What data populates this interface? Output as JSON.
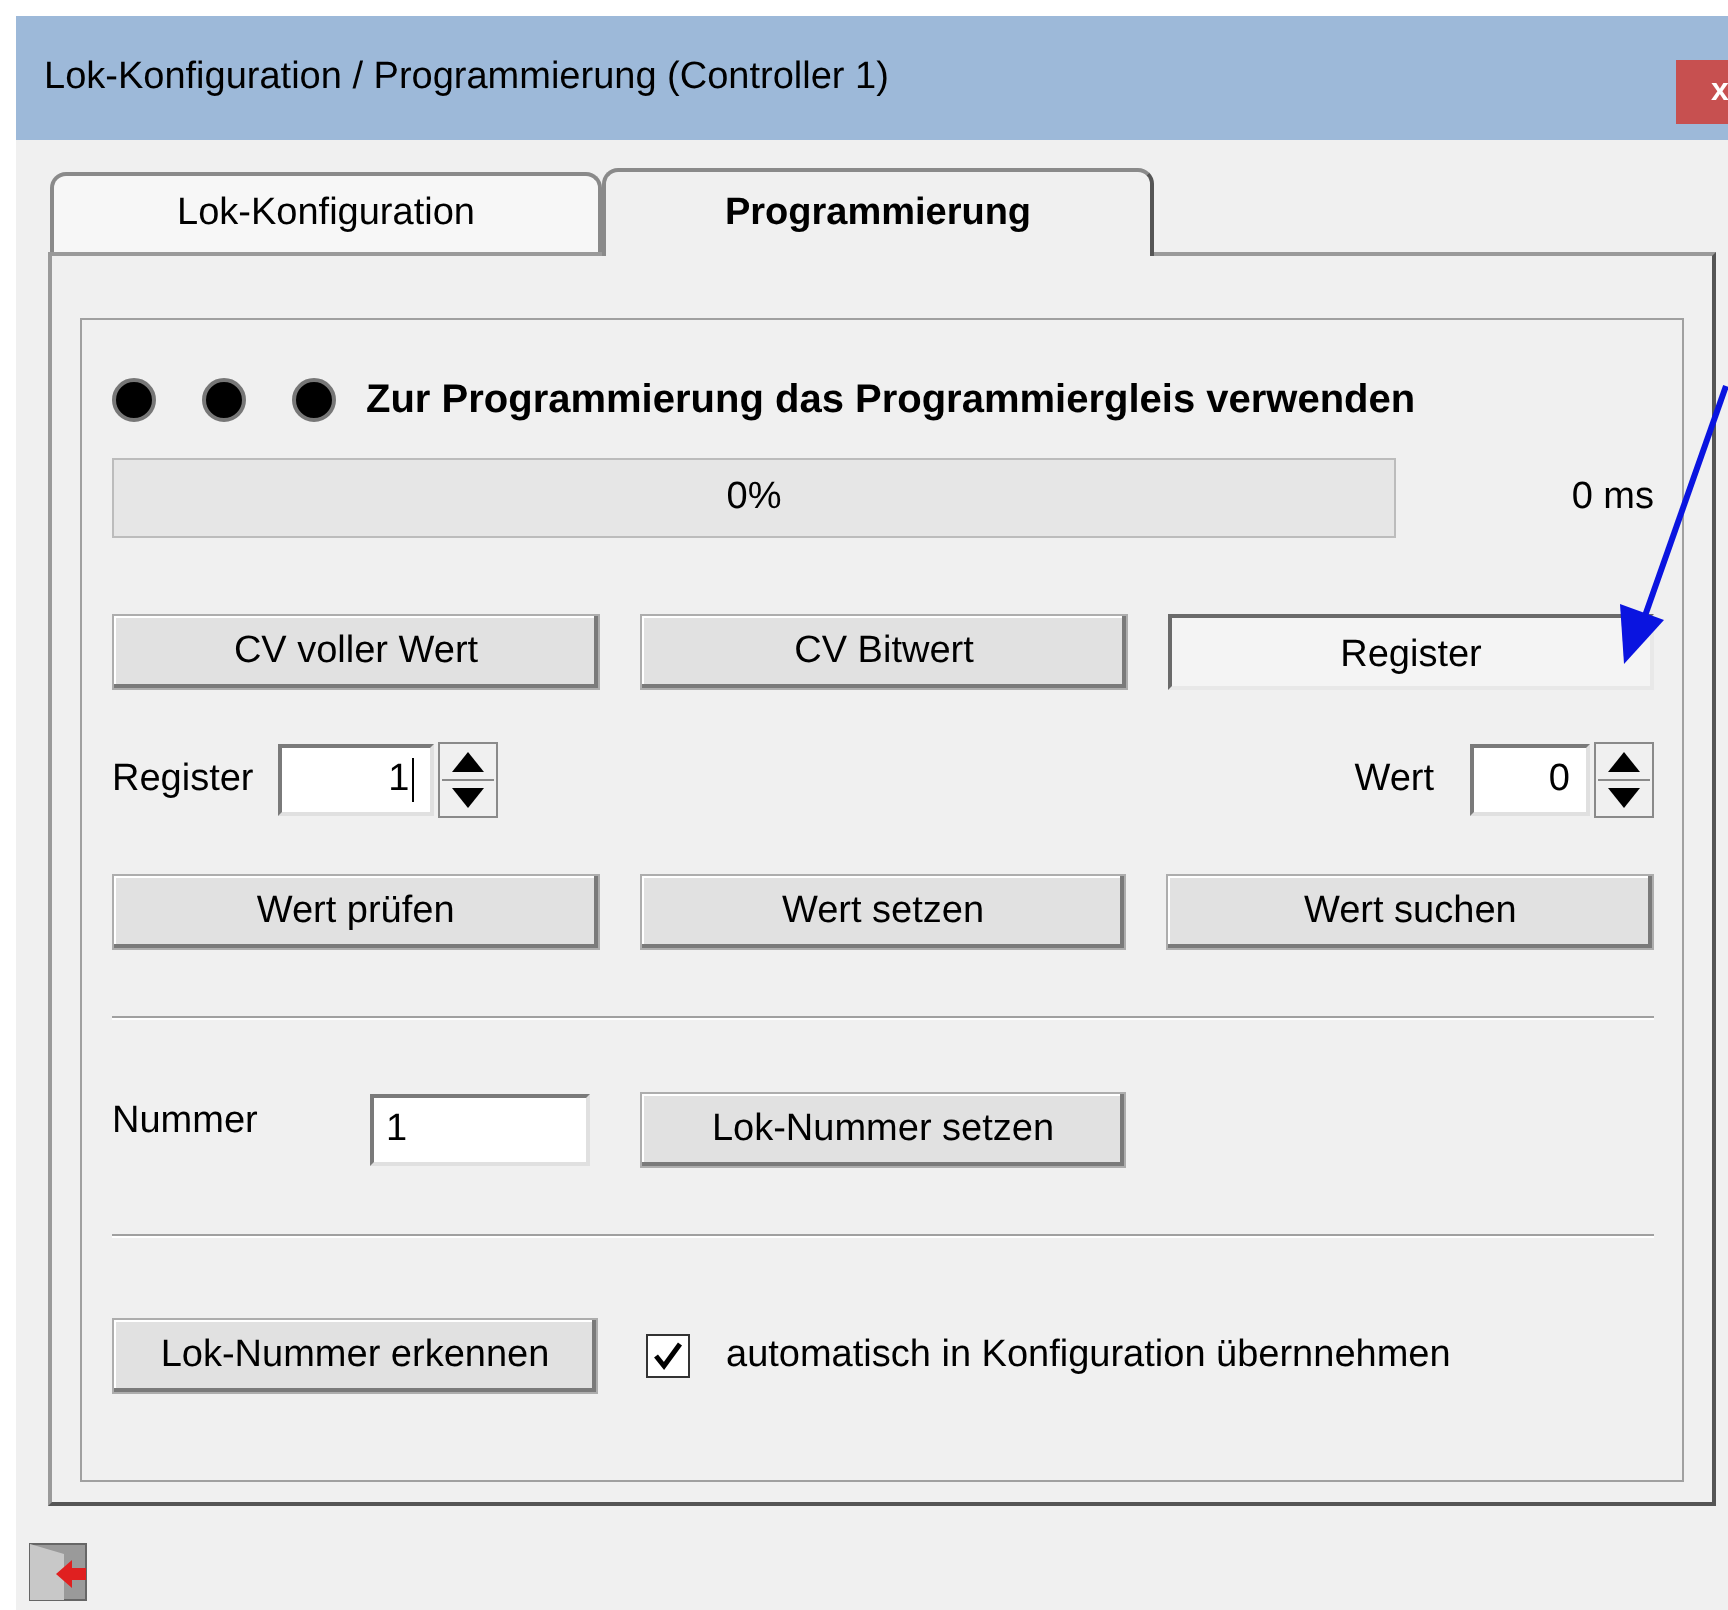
{
  "window": {
    "title": "Lok-Konfiguration / Programmierung (Controller 1)",
    "close": "x"
  },
  "tabs": [
    {
      "label": "Lok-Konfiguration",
      "selected": false
    },
    {
      "label": "Programmierung",
      "selected": true
    }
  ],
  "heading": "Zur Programmierung das Programmiergleis verwenden",
  "progress": {
    "label": "0%",
    "level": 0
  },
  "duration": "0 ms",
  "modes": [
    {
      "label": "CV voller Wert",
      "selected": false
    },
    {
      "label": "CV Bitwert",
      "selected": false
    },
    {
      "label": "Register",
      "selected": true
    }
  ],
  "register": {
    "label": "Register",
    "value": "1"
  },
  "wert": {
    "label": "Wert",
    "value": "0"
  },
  "actions": [
    "Wert prüfen",
    "Wert setzen",
    "Wert suchen"
  ],
  "nummer": {
    "label": "Nummer",
    "value": "1"
  },
  "set_button": "Lok-Nummer setzen",
  "detect_button": "Lok-Nummer erkennen",
  "auto_apply": {
    "label": "automatisch in Konfiguration übernnehmen",
    "checked": true
  }
}
